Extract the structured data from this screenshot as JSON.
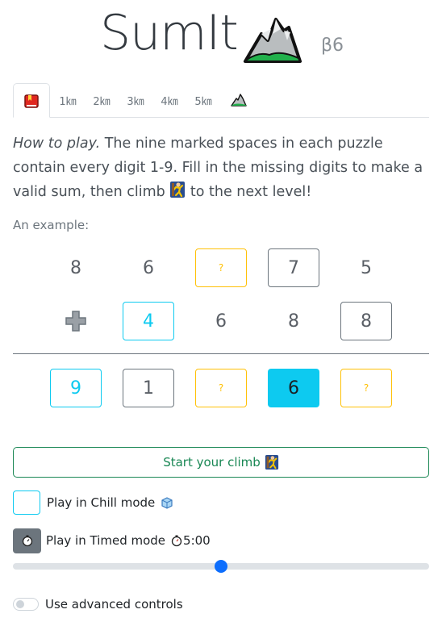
{
  "header": {
    "title": "SumIt",
    "version": "β6",
    "logo_icon": "mountain-icon"
  },
  "tabs": [
    {
      "label": "",
      "icon": "red-book-icon",
      "active": true
    },
    {
      "label": "1㎞",
      "active": false
    },
    {
      "label": "2㎞",
      "active": false
    },
    {
      "label": "3㎞",
      "active": false
    },
    {
      "label": "4㎞",
      "active": false
    },
    {
      "label": "5㎞",
      "active": false
    },
    {
      "label": "",
      "icon": "mountain-icon",
      "active": false
    }
  ],
  "howto": {
    "lead": "How to play.",
    "text1": " The nine marked spaces in each puzzle contain every digit 1-9. Fill in the missing digits to make a valid sum, then climb ",
    "text2": " to the next level!",
    "climber_icon": "climber-icon"
  },
  "example": {
    "label": "An example:",
    "rows": [
      [
        {
          "value": "8",
          "style": "plain"
        },
        {
          "value": "6",
          "style": "plain"
        },
        {
          "value": "?",
          "style": "yellow"
        },
        {
          "value": "7",
          "style": "dark"
        },
        {
          "value": "5",
          "style": "plain"
        }
      ],
      [
        {
          "value": "",
          "style": "plus"
        },
        {
          "value": "4",
          "style": "cyan"
        },
        {
          "value": "6",
          "style": "plain"
        },
        {
          "value": "8",
          "style": "plain"
        },
        {
          "value": "8",
          "style": "dark"
        }
      ],
      [
        {
          "value": "9",
          "style": "cyan"
        },
        {
          "value": "1",
          "style": "dark"
        },
        {
          "value": "?",
          "style": "yellow"
        },
        {
          "value": "6",
          "style": "fill"
        },
        {
          "value": "?",
          "style": "yellow"
        }
      ]
    ]
  },
  "controls": {
    "start_label": "Start your climb",
    "chill_label": "Play in Chill mode",
    "chill_icon": "ice-cube-icon",
    "timed_label": "Play in Timed mode",
    "timed_value": "5:00",
    "timer_icon": "stopwatch-icon",
    "slider_level": 0.5,
    "advanced_label": "Use advanced controls",
    "advanced_on": false
  },
  "colors": {
    "cyan": "#0dcaf0",
    "yellow": "#ffc107",
    "green": "#198754",
    "blue": "#0d6efd"
  }
}
